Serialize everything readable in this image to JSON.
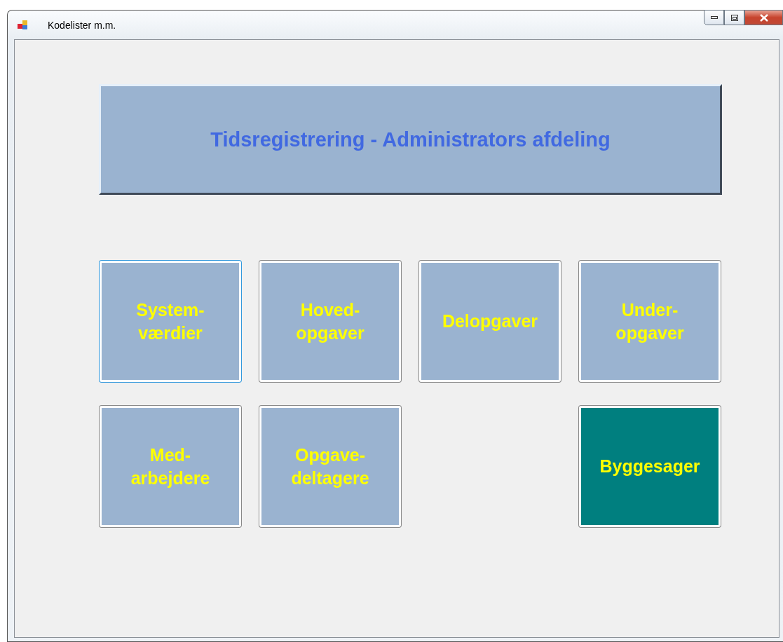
{
  "window": {
    "title": "Kodelister m.m."
  },
  "banner": {
    "label": "Tidsregistrering - Administrators afdeling"
  },
  "rows": [
    {
      "items": [
        {
          "kind": "button",
          "label": "System-\nværdier",
          "color": "#9ab3d0",
          "focused": true
        },
        {
          "kind": "button",
          "label": "Hoved-\nopgaver",
          "color": "#9ab3d0",
          "focused": false
        },
        {
          "kind": "button",
          "label": "Delopgaver",
          "color": "#9ab3d0",
          "focused": false
        },
        {
          "kind": "button",
          "label": "Under-\nopgaver",
          "color": "#9ab3d0",
          "focused": false
        }
      ]
    },
    {
      "items": [
        {
          "kind": "button",
          "label": "Med-\narbejdere",
          "color": "#9ab3d0",
          "focused": false
        },
        {
          "kind": "button",
          "label": "Opgave-\ndeltagere",
          "color": "#9ab3d0",
          "focused": false
        },
        {
          "kind": "gap"
        },
        {
          "kind": "button",
          "label": "Byggesager",
          "color": "#007f7f",
          "focused": false
        }
      ]
    }
  ]
}
